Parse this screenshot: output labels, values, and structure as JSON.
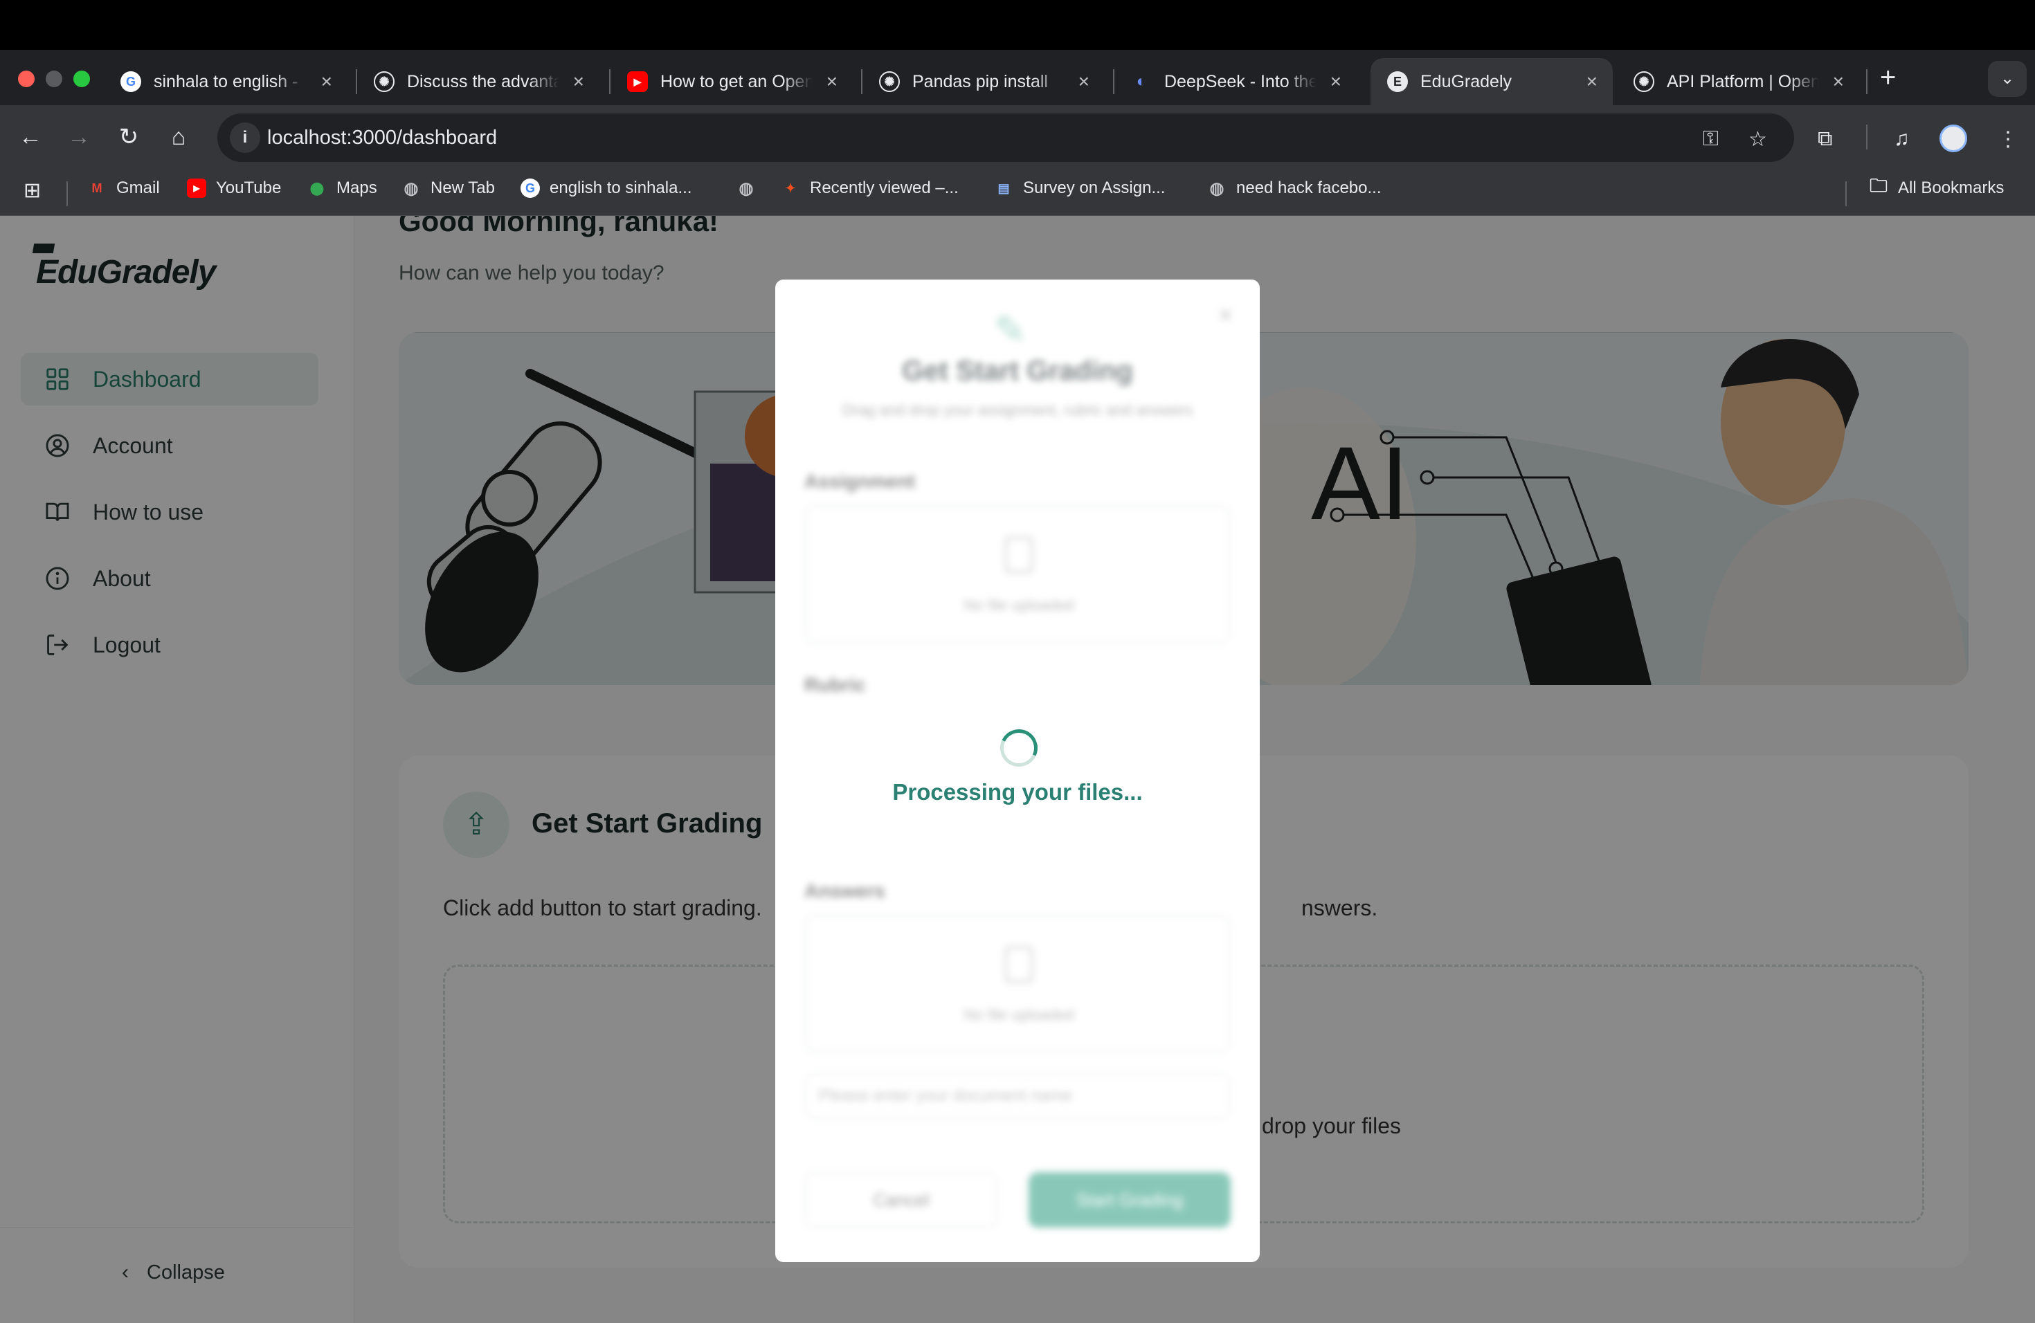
{
  "browser": {
    "tabs": [
      {
        "title": "sinhala to english -",
        "icon": "google-icon",
        "active": false
      },
      {
        "title": "Discuss the advantages",
        "icon": "openai-icon",
        "active": false
      },
      {
        "title": "How to get an OpenAI",
        "icon": "youtube-icon",
        "active": false
      },
      {
        "title": "Pandas pip install",
        "icon": "openai-icon",
        "active": false
      },
      {
        "title": "DeepSeek - Into the",
        "icon": "deepseek-icon",
        "active": false
      },
      {
        "title": "EduGradely",
        "icon": "edugradely-icon",
        "active": true
      },
      {
        "title": "API Platform | OpenAI",
        "icon": "openai-icon",
        "active": false
      }
    ],
    "url": "localhost:3000/dashboard",
    "bookmarks": [
      {
        "label": "Gmail",
        "icon": "gmail-icon"
      },
      {
        "label": "YouTube",
        "icon": "youtube-icon"
      },
      {
        "label": "Maps",
        "icon": "maps-icon"
      },
      {
        "label": "New Tab",
        "icon": "globe-icon"
      },
      {
        "label": "english to sinhala...",
        "icon": "google-icon"
      },
      {
        "label": "",
        "icon": "globe-icon"
      },
      {
        "label": "Recently viewed –...",
        "icon": "figma-icon"
      },
      {
        "label": "Survey on Assign...",
        "icon": "forms-icon"
      },
      {
        "label": "need hack facebo...",
        "icon": "globe-icon"
      }
    ],
    "all_bookmarks": "All Bookmarks"
  },
  "app": {
    "logo": "EduGradely",
    "nav": [
      {
        "label": "Dashboard",
        "icon": "dashboard-icon",
        "active": true
      },
      {
        "label": "Account",
        "icon": "account-icon",
        "active": false
      },
      {
        "label": "How to use",
        "icon": "book-icon",
        "active": false
      },
      {
        "label": "About",
        "icon": "info-icon",
        "active": false
      },
      {
        "label": "Logout",
        "icon": "logout-icon",
        "active": false
      }
    ],
    "collapse_label": "Collapse",
    "greeting": "Good Morning, ranuka!",
    "subgreeting": "How can we help you today?",
    "hero_text": "AI",
    "grading": {
      "title": "Get Start Grading",
      "desc_start": "Click add button to start grading.",
      "desc_end": "nswers.",
      "drop_text": "drop your files"
    }
  },
  "modal": {
    "title": "Get Start Grading",
    "subtitle": "Drag and drop your assignment, rubric and answers",
    "sections": [
      "Assignment",
      "Rubric",
      "Answers"
    ],
    "no_file": "No file uploaded",
    "input_placeholder": "Please enter your document name",
    "cancel_label": "Cancel",
    "submit_label": "Start Grading",
    "processing_text": "Processing your files..."
  },
  "colors": {
    "accent": "#2a8f78",
    "active_nav_bg": "#eaf4f0",
    "overlay": "rgba(0,0,0,0.46)"
  }
}
